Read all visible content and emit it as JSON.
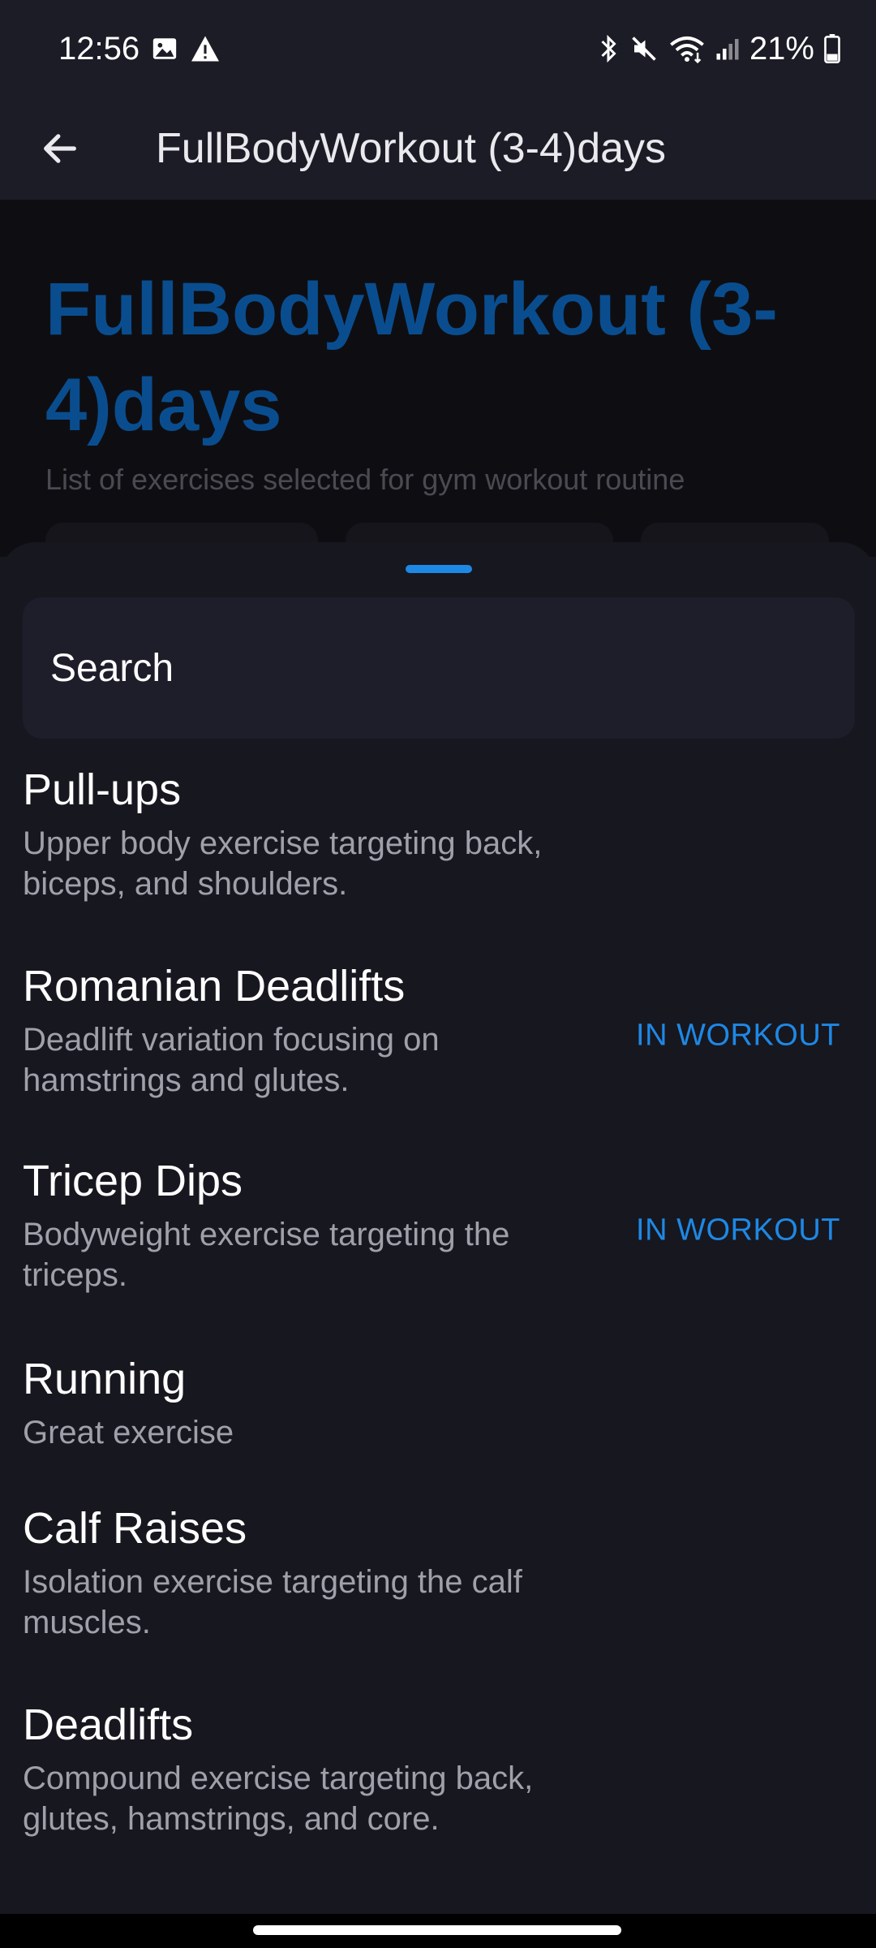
{
  "status_bar": {
    "time": "12:56",
    "battery_percent": "21%",
    "icons_left": [
      "image-icon",
      "warning-icon"
    ],
    "icons_right": [
      "bluetooth-icon",
      "mute-icon",
      "wifi-icon",
      "signal-icon",
      "battery-icon"
    ]
  },
  "app_bar": {
    "title": "FullBodyWorkout (3-4)days"
  },
  "background": {
    "title": "FullBodyWorkout (3-4)days",
    "subtitle": "List of exercises selected for gym workout routine"
  },
  "sheet": {
    "search_label": "Search",
    "exercises": [
      {
        "name": "Pull-ups",
        "description": "Upper body exercise targeting back, biceps, and shoulders.",
        "badge": ""
      },
      {
        "name": "Romanian Deadlifts",
        "description": "Deadlift variation focusing on hamstrings and glutes.",
        "badge": "IN WORKOUT"
      },
      {
        "name": "Tricep Dips",
        "description": "Bodyweight exercise targeting the triceps.",
        "badge": "IN WORKOUT"
      },
      {
        "name": "Running",
        "description": "Great exercise",
        "badge": ""
      },
      {
        "name": "Calf Raises",
        "description": "Isolation exercise targeting the calf muscles.",
        "badge": ""
      },
      {
        "name": "Deadlifts",
        "description": "Compound exercise targeting back, glutes, hamstrings, and core.",
        "badge": ""
      }
    ]
  },
  "colors": {
    "accent": "#1e88e5",
    "background": "#17171f",
    "app_bar": "#1c1c26",
    "secondary_text": "#a0a0aa"
  }
}
